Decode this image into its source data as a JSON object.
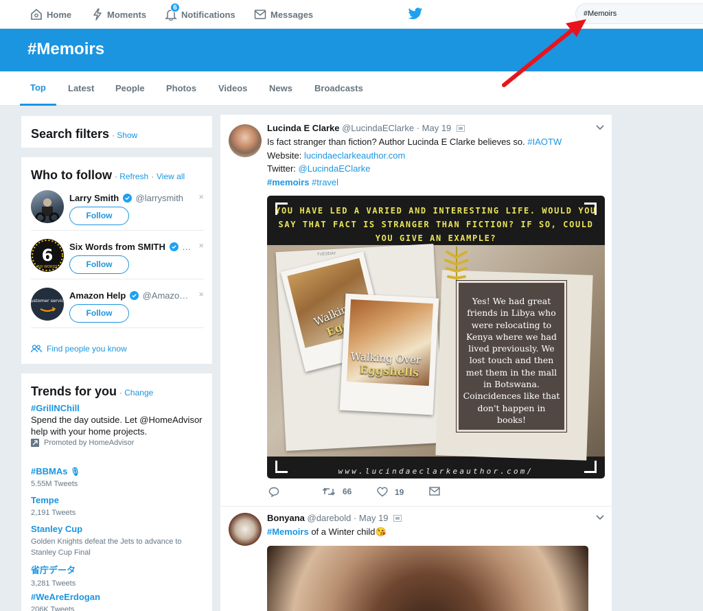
{
  "nav": {
    "home": "Home",
    "moments": "Moments",
    "notifications": "Notifications",
    "notifications_count": "6",
    "messages": "Messages"
  },
  "search": {
    "value": "#Memoirs"
  },
  "banner": {
    "title": "#Memoirs"
  },
  "tabs": [
    "Top",
    "Latest",
    "People",
    "Photos",
    "Videos",
    "News",
    "Broadcasts"
  ],
  "search_filters": {
    "title": "Search filters",
    "link": "Show"
  },
  "who_to_follow": {
    "title": "Who to follow",
    "refresh": "Refresh",
    "sep": "·",
    "view_all": "View all",
    "follow_label": "Follow",
    "dismiss": "×",
    "users": [
      {
        "name": "Larry Smith",
        "handle": "@larrysmith"
      },
      {
        "name": "Six Words from SMITH",
        "handle": "…"
      },
      {
        "name": "Amazon Help",
        "handle": "@Amazo…"
      }
    ],
    "find_people": "Find people you know",
    "six_avatar_number": "6",
    "six_avatar_text": "SIX WORDS",
    "amazon_avatar_text": "customer service"
  },
  "trends": {
    "title": "Trends for you",
    "change": "Change",
    "items": [
      {
        "name": "#GrillNChill",
        "desc": "Spend the day outside. Let @HomeAdvisor help with your home projects.",
        "promoted": "Promoted by HomeAdvisor"
      },
      {
        "name": "#BBMAs",
        "meta": "5.55M Tweets"
      },
      {
        "name": "Tempe",
        "meta": "2,191 Tweets"
      },
      {
        "name": "Stanley Cup",
        "meta": "Golden Knights defeat the Jets to advance to Stanley Cup Final"
      },
      {
        "name": "省庁データ",
        "meta": "3,281 Tweets"
      },
      {
        "name": "#WeAreErdogan",
        "meta": "206K Tweets"
      }
    ]
  },
  "tweets": [
    {
      "name": "Lucinda E Clarke",
      "handle": "@LucindaEClarke",
      "date": "· May 19",
      "line1": "Is fact stranger than fiction? Author Lucinda E Clarke believes so. ",
      "line1_tag": "#IAOTW",
      "website_label": "Website: ",
      "website": "lucindaeclarkeauthor.com",
      "twitter_label": "Twitter: ",
      "twitter": "@LucindaEClarke",
      "tag_memoirs": "#memoirs",
      "tag_travel": " #travel",
      "media_question": "YOU HAVE LED A VARIED AND INTERESTING LIFE. WOULD YOU SAY THAT FACT IS STRANGER THAN FICTION? IF SO, COULD YOU GIVE AN EXAMPLE?",
      "media_answer": "Yes! We had great friends in Libya who were relocating to Kenya where we had lived previously. We lost touch and then met them in the mall in Botswana. Coincidences like that don't happen in books!",
      "media_url": "www.lucindaeclarkeauthor.com/",
      "book_title_a": "Walkin",
      "book_sub_a": "Egg",
      "book_title": "Walking Over",
      "book_sub": "Eggshells",
      "notebook_label": "TUESDAY",
      "retweets": "66",
      "likes": "19"
    },
    {
      "name": "Bonyana",
      "handle": "@darebold",
      "date": "· May 19",
      "tag": "#Memoirs",
      "text": " of a Winter child😘"
    }
  ],
  "colors": {
    "brand": "#1b95e0",
    "banner": "#1b95e0",
    "arrow": "#e8141c"
  }
}
